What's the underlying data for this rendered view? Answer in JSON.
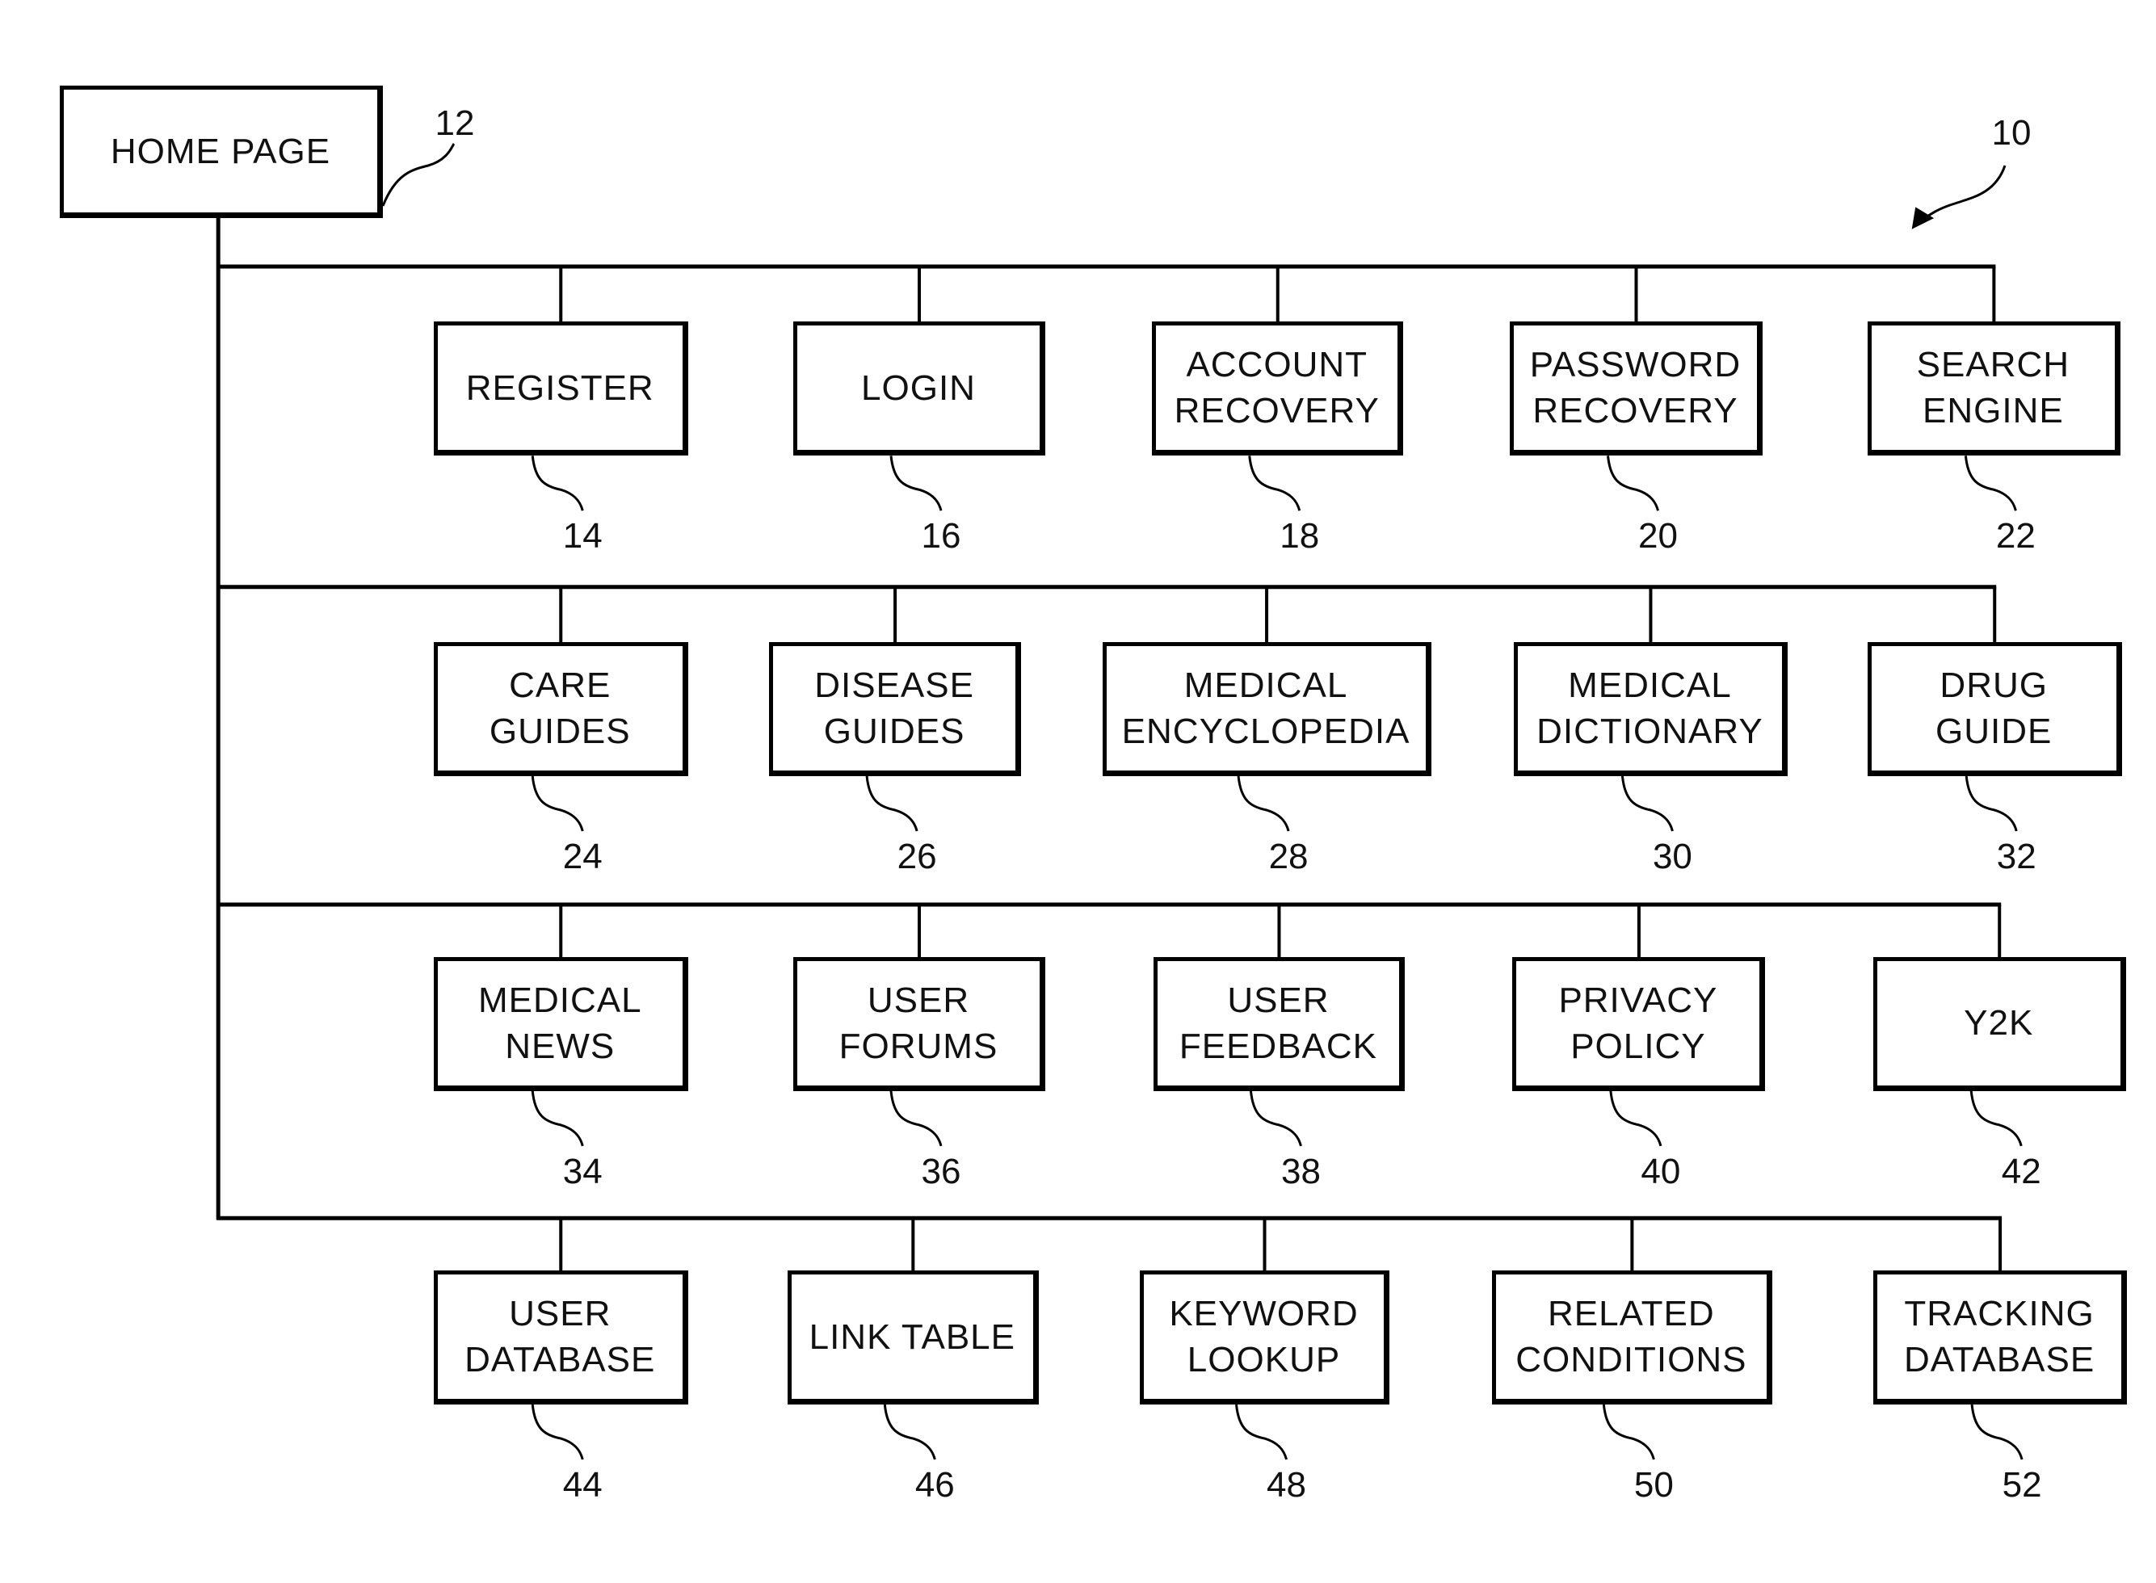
{
  "figure": {
    "ref": "10",
    "root": {
      "label": "HOME PAGE",
      "ref": "12"
    },
    "rows": [
      [
        {
          "label": "REGISTER",
          "ref": "14"
        },
        {
          "label": "LOGIN",
          "ref": "16"
        },
        {
          "label": "ACCOUNT\nRECOVERY",
          "ref": "18"
        },
        {
          "label": "PASSWORD\nRECOVERY",
          "ref": "20"
        },
        {
          "label": "SEARCH\nENGINE",
          "ref": "22"
        }
      ],
      [
        {
          "label": "CARE\nGUIDES",
          "ref": "24"
        },
        {
          "label": "DISEASE\nGUIDES",
          "ref": "26"
        },
        {
          "label": "MEDICAL\nENCYCLOPEDIA",
          "ref": "28"
        },
        {
          "label": "MEDICAL\nDICTIONARY",
          "ref": "30"
        },
        {
          "label": "DRUG\nGUIDE",
          "ref": "32"
        }
      ],
      [
        {
          "label": "MEDICAL\nNEWS",
          "ref": "34"
        },
        {
          "label": "USER\nFORUMS",
          "ref": "36"
        },
        {
          "label": "USER\nFEEDBACK",
          "ref": "38"
        },
        {
          "label": "PRIVACY\nPOLICY",
          "ref": "40"
        },
        {
          "label": "Y2K",
          "ref": "42"
        }
      ],
      [
        {
          "label": "USER\nDATABASE",
          "ref": "44"
        },
        {
          "label": "LINK TABLE",
          "ref": "46"
        },
        {
          "label": "KEYWORD\nLOOKUP",
          "ref": "48"
        },
        {
          "label": "RELATED\nCONDITIONS",
          "ref": "50"
        },
        {
          "label": "TRACKING\nDATABASE",
          "ref": "52"
        }
      ]
    ]
  }
}
